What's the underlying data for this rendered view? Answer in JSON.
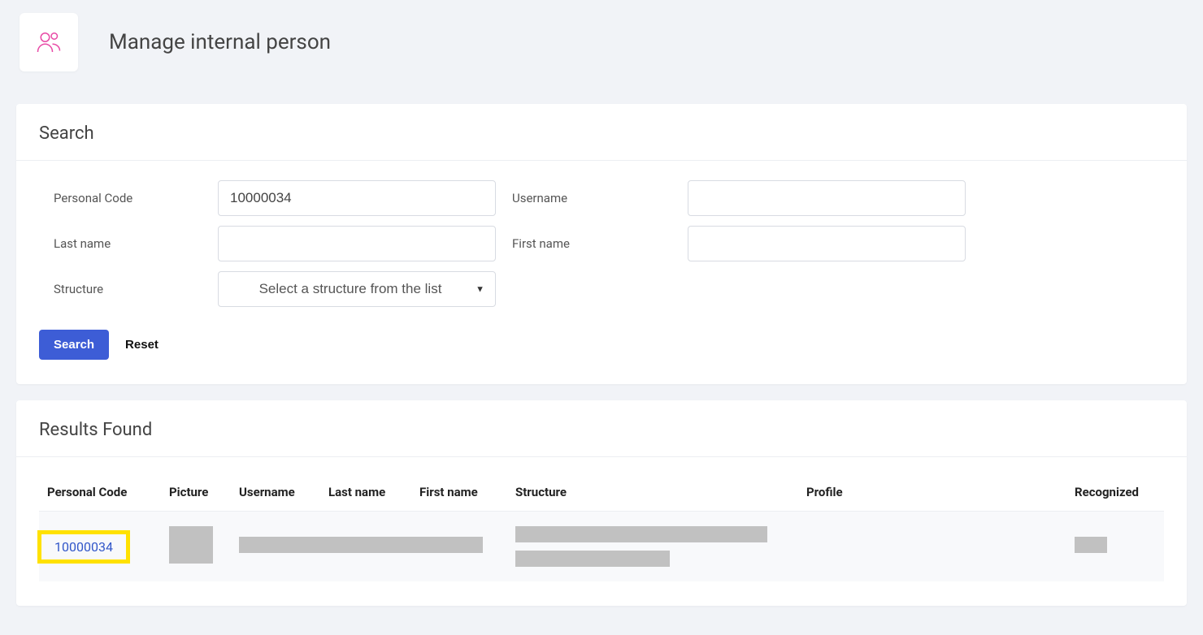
{
  "page": {
    "title": "Manage internal person"
  },
  "search": {
    "heading": "Search",
    "labels": {
      "personal_code": "Personal Code",
      "username": "Username",
      "last_name": "Last name",
      "first_name": "First name",
      "structure": "Structure"
    },
    "values": {
      "personal_code": "10000034",
      "username": "",
      "last_name": "",
      "first_name": ""
    },
    "structure_placeholder": "Select a structure from the list",
    "buttons": {
      "search": "Search",
      "reset": "Reset"
    }
  },
  "results": {
    "heading": "Results Found",
    "columns": {
      "personal_code": "Personal Code",
      "picture": "Picture",
      "username": "Username",
      "last_name": "Last name",
      "first_name": "First name",
      "structure": "Structure",
      "profile": "Profile",
      "recognized": "Recognized"
    },
    "rows": [
      {
        "personal_code": "10000034"
      }
    ]
  }
}
